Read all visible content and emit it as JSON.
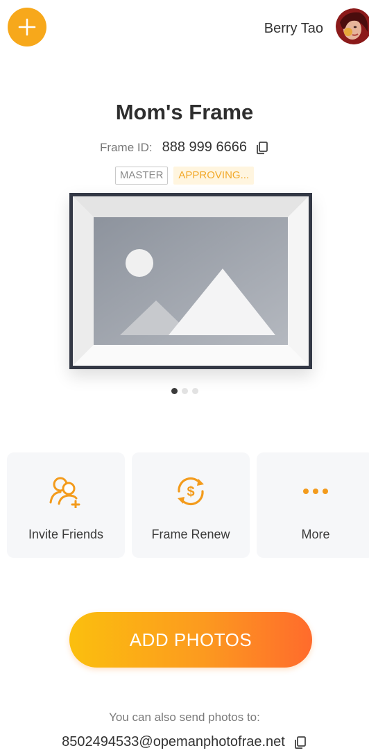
{
  "header": {
    "add_icon": "plus-icon",
    "user_name": "Berry Tao"
  },
  "frame": {
    "title": "Mom's Frame",
    "id_label": "Frame ID:",
    "id_value": "888 999 6666",
    "badges": {
      "master": "MASTER",
      "status": "APPROVING..."
    },
    "carousel": {
      "total": 3,
      "active": 1
    }
  },
  "actions": [
    {
      "label": "Invite Friends",
      "icon": "invite-friends-icon"
    },
    {
      "label": "Frame Renew",
      "icon": "renew-dollar-icon"
    },
    {
      "label": "More",
      "icon": "more-dots-icon"
    }
  ],
  "cta": {
    "label": "ADD PHOTOS"
  },
  "footer": {
    "note": "You can also send photos to:",
    "email": "8502494533@opemanphotofrae.net"
  },
  "colors": {
    "accent": "#f7a81b",
    "status": "#f2a92a",
    "frame_border": "#333845",
    "gradient_start": "#fbbf0e",
    "gradient_end": "#ff6b2c"
  }
}
